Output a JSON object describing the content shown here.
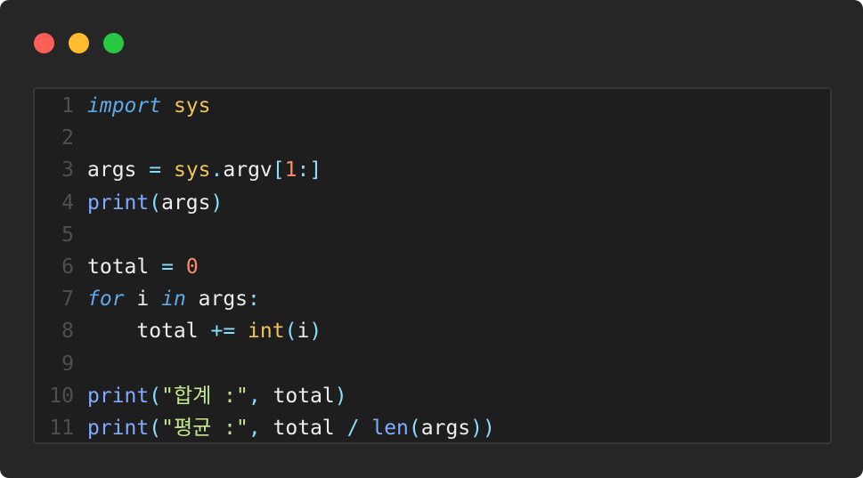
{
  "window": {
    "controls": [
      "close",
      "minimize",
      "maximize"
    ]
  },
  "editor": {
    "lines": [
      {
        "number": "1",
        "tokens": [
          {
            "t": "import",
            "c": "kw"
          },
          {
            "t": " ",
            "c": "plain"
          },
          {
            "t": "sys",
            "c": "mod"
          }
        ]
      },
      {
        "number": "2",
        "tokens": []
      },
      {
        "number": "3",
        "tokens": [
          {
            "t": "args",
            "c": "plain"
          },
          {
            "t": " ",
            "c": "plain"
          },
          {
            "t": "=",
            "c": "op"
          },
          {
            "t": " ",
            "c": "plain"
          },
          {
            "t": "sys",
            "c": "mod"
          },
          {
            "t": ".",
            "c": "op"
          },
          {
            "t": "argv",
            "c": "plain"
          },
          {
            "t": "[",
            "c": "bracket"
          },
          {
            "t": "1",
            "c": "num"
          },
          {
            "t": ":",
            "c": "op"
          },
          {
            "t": "]",
            "c": "bracket"
          }
        ]
      },
      {
        "number": "4",
        "tokens": [
          {
            "t": "print",
            "c": "fn"
          },
          {
            "t": "(",
            "c": "bracket"
          },
          {
            "t": "args",
            "c": "plain"
          },
          {
            "t": ")",
            "c": "bracket"
          }
        ]
      },
      {
        "number": "5",
        "tokens": []
      },
      {
        "number": "6",
        "tokens": [
          {
            "t": "total",
            "c": "plain"
          },
          {
            "t": " ",
            "c": "plain"
          },
          {
            "t": "=",
            "c": "op"
          },
          {
            "t": " ",
            "c": "plain"
          },
          {
            "t": "0",
            "c": "num"
          }
        ]
      },
      {
        "number": "7",
        "tokens": [
          {
            "t": "for",
            "c": "kw"
          },
          {
            "t": " i ",
            "c": "plain"
          },
          {
            "t": "in",
            "c": "kw"
          },
          {
            "t": " args",
            "c": "plain"
          },
          {
            "t": ":",
            "c": "op"
          }
        ]
      },
      {
        "number": "8",
        "tokens": [
          {
            "t": "    total ",
            "c": "plain"
          },
          {
            "t": "+=",
            "c": "op"
          },
          {
            "t": " ",
            "c": "plain"
          },
          {
            "t": "int",
            "c": "mod"
          },
          {
            "t": "(",
            "c": "bracket"
          },
          {
            "t": "i",
            "c": "plain"
          },
          {
            "t": ")",
            "c": "bracket"
          }
        ]
      },
      {
        "number": "9",
        "tokens": []
      },
      {
        "number": "10",
        "tokens": [
          {
            "t": "print",
            "c": "fn"
          },
          {
            "t": "(",
            "c": "bracket"
          },
          {
            "t": "\"합계 :\"",
            "c": "str"
          },
          {
            "t": ",",
            "c": "op"
          },
          {
            "t": " total",
            "c": "plain"
          },
          {
            "t": ")",
            "c": "bracket"
          }
        ]
      },
      {
        "number": "11",
        "tokens": [
          {
            "t": "print",
            "c": "fn"
          },
          {
            "t": "(",
            "c": "bracket"
          },
          {
            "t": "\"평균 :\"",
            "c": "str"
          },
          {
            "t": ",",
            "c": "op"
          },
          {
            "t": " total ",
            "c": "plain"
          },
          {
            "t": "/",
            "c": "op"
          },
          {
            "t": " ",
            "c": "plain"
          },
          {
            "t": "len",
            "c": "fn"
          },
          {
            "t": "(",
            "c": "bracket"
          },
          {
            "t": "args",
            "c": "plain"
          },
          {
            "t": "))",
            "c": "bracket"
          }
        ]
      }
    ]
  }
}
